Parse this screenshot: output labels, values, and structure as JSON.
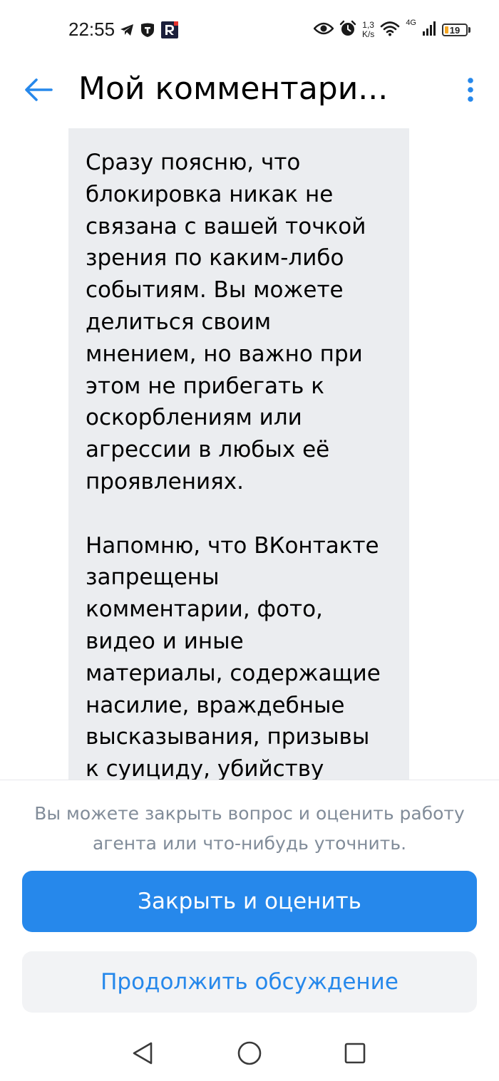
{
  "status_bar": {
    "time": "22:55",
    "net_speed_value": "1,3",
    "net_speed_unit": "K/s",
    "network_type": "4G",
    "battery_level": "19",
    "battery_fraction": 0.19,
    "battery_color": "#f5a623",
    "left_icons": [
      "telegram-icon",
      "shield-app-icon",
      "r-app-icon"
    ],
    "right_icons": [
      "eye-icon",
      "alarm-icon",
      "wifi-icon",
      "signal-icon",
      "battery-icon"
    ]
  },
  "header": {
    "title": "Мой комментари...",
    "back_icon": "arrow-left-icon",
    "menu_icon": "more-vertical-icon",
    "accent_color": "#2688eb"
  },
  "chat": {
    "message": "Сразу поясню, что\nблокировка никак не\nсвязана с вашей точкой\nзрения по каким-либо\nсобытиям. Вы можете\nделиться своим\nмнением, но важно при\nэтом не прибегать к\nоскорблениям или\nагрессии в любых её\nпроявлениях.\n\nНапомню, что ВКонтакте\nзапрещены\nкомментарии, фото,\nвидео и иные\nматериалы, содержащие\nнасилие, враждебные\nвысказывания, призывы\nк суициду, убийству",
    "bubble_color": "#ebedf0"
  },
  "footer": {
    "hint": "Вы можете закрыть вопрос и оценить работу агента или что-нибудь уточнить.",
    "close_and_rate_label": "Закрыть и оценить",
    "continue_label": "Продолжить обсуждение"
  },
  "system_nav": {
    "icons": [
      "nav-back-icon",
      "nav-home-icon",
      "nav-recents-icon"
    ]
  }
}
